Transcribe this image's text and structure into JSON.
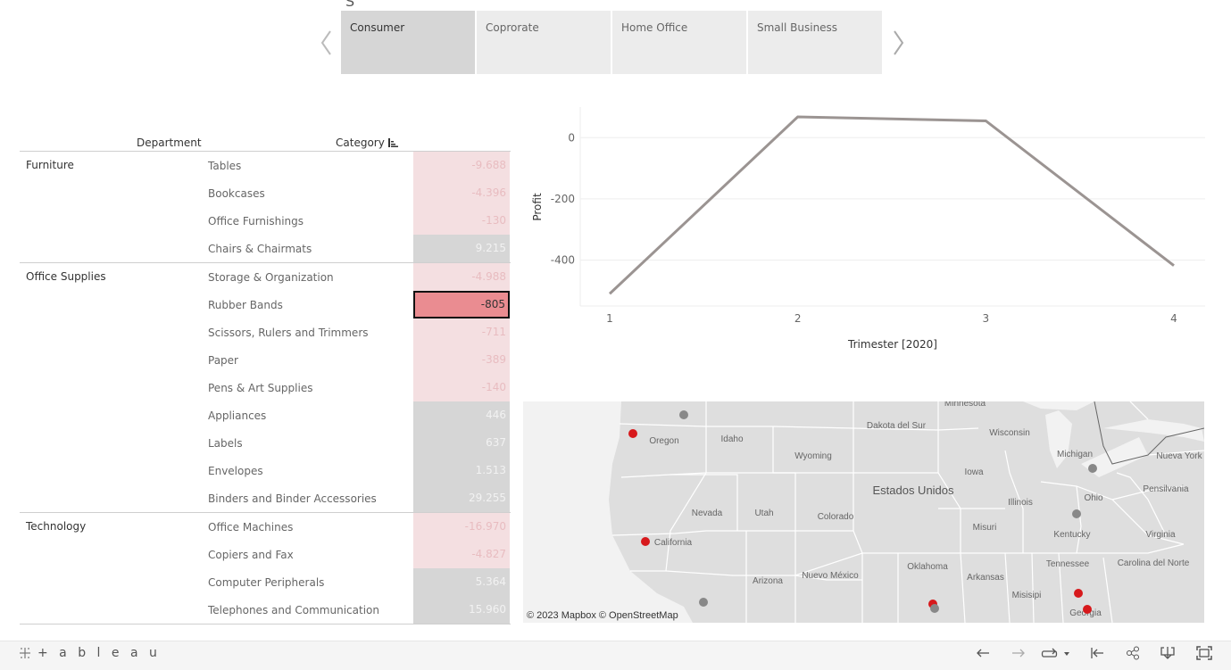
{
  "segments": {
    "title_fragment": "S",
    "tabs": [
      "Consumer",
      "Coprorate",
      "Home Office",
      "Small Business"
    ],
    "active": "Consumer"
  },
  "table": {
    "headers": {
      "department": "Department",
      "category": "Category"
    },
    "departments": [
      {
        "name": "Furniture",
        "rows": [
          {
            "category": "Tables",
            "value": "-9.688"
          },
          {
            "category": "Bookcases",
            "value": "-4.396"
          },
          {
            "category": "Office Furnishings",
            "value": "-130"
          },
          {
            "category": "Chairs & Chairmats",
            "value": "9.215"
          }
        ]
      },
      {
        "name": "Office Supplies",
        "rows": [
          {
            "category": "Storage & Organization",
            "value": "-4.988"
          },
          {
            "category": "Rubber Bands",
            "value": "-805"
          },
          {
            "category": "Scissors, Rulers and Trimmers",
            "value": "-711"
          },
          {
            "category": "Paper",
            "value": "-389"
          },
          {
            "category": "Pens & Art Supplies",
            "value": "-140"
          },
          {
            "category": "Appliances",
            "value": "446"
          },
          {
            "category": "Labels",
            "value": "637"
          },
          {
            "category": "Envelopes",
            "value": "1.513"
          },
          {
            "category": "Binders and Binder Accessories",
            "value": "29.255"
          }
        ]
      },
      {
        "name": "Technology",
        "rows": [
          {
            "category": "Office Machines",
            "value": "-16.970"
          },
          {
            "category": "Copiers and Fax",
            "value": "-4.827"
          },
          {
            "category": "Computer Peripherals",
            "value": "5.364"
          },
          {
            "category": "Telephones and Communication",
            "value": "15.960"
          }
        ]
      }
    ],
    "selected_category": "Rubber Bands"
  },
  "chart_data": {
    "type": "line",
    "x": [
      1,
      2,
      3,
      4
    ],
    "y": [
      -510,
      68,
      55,
      -418
    ],
    "xlabel": "Trimester [2020]",
    "ylabel": "Profit",
    "yticks": [
      0,
      -200,
      -400
    ],
    "ylim": [
      -550,
      100
    ],
    "color": "#9b9492"
  },
  "map": {
    "labels": [
      "Minnesota",
      "Dakota del Sur",
      "Wisconsin",
      "Oregon",
      "Idaho",
      "Wyoming",
      "Iowa",
      "Michigan",
      "Nueva York",
      "Estados Unidos",
      "Ohio",
      "Pensilvania",
      "Nevada",
      "Utah",
      "Colorado",
      "Illinois",
      "California",
      "Misuri",
      "Kentucky",
      "Virginia",
      "Oklahoma",
      "Tennessee",
      "Carolina del Norte",
      "Arizona",
      "Nuevo México",
      "Arkansas",
      "Misisipi",
      "Georgia"
    ],
    "credit": "© 2023 Mapbox  © OpenStreetMap",
    "marker_colors": {
      "loss": "#d7191c",
      "profit": "#888888"
    }
  },
  "toolbar": {
    "logo": "+ a b l e a u",
    "icons": [
      "undo-icon",
      "redo-icon",
      "replay-icon",
      "revert-icon",
      "share-icon",
      "download-icon",
      "fullscreen-icon"
    ]
  }
}
